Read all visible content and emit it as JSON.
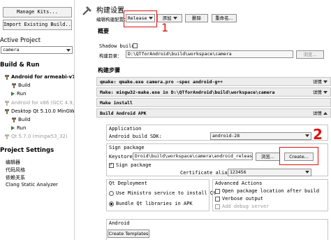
{
  "left": {
    "buttons": {
      "manage_kits": "Manage Kits...",
      "import_build": "Import Existing Build..."
    },
    "active_project_heading": "Active Project",
    "project_select_value": "camera",
    "build_run_heading": "Build & Run",
    "kits": [
      {
        "name": "Android for armeabi-v7a...",
        "build": "Build",
        "run": "Run",
        "active": true
      },
      {
        "name": "Android for x86 (GCC 4.9, ..."
      },
      {
        "name": "Desktop Qt 5.10.0 MinGW...",
        "build": "Build",
        "run": "Run"
      },
      {
        "name": "Qt 5.7.0 (mingw53_32)"
      }
    ],
    "project_settings_heading": "Project Settings",
    "settings_items": [
      "编辑器",
      "代码风格",
      "依赖关系",
      "Clang Static Analyzer"
    ]
  },
  "main": {
    "title": "构建设置",
    "edit_config_label": "编辑构建配置：",
    "config_value": "Release",
    "add_button": "添加",
    "delete_button": "删除",
    "rename_button": "重命名...",
    "general_heading": "概要",
    "shadow_build_label": "Shadow build:",
    "build_dir_label": "构建目录：",
    "build_dir_value": "D:\\QTforAndroid\\build\\workspace\\camera",
    "browse_label": "浏览...",
    "build_steps_heading": "构建步骤",
    "details_label": "详情",
    "steps": [
      "qmake: qmake.exe camera.pro -spec android-g++",
      "Make: mingw32-make.exe in D:\\QTforAndroid\\build\\workspace\\camera",
      "Make install",
      "Build Android APK"
    ],
    "apk": {
      "application_label": "Application",
      "sdk_label": "Android build SDK:",
      "sdk_value": "android-28",
      "sign_package_label": "Sign package",
      "keystore_label": "Keystore:",
      "keystore_value": "Droid\\build\\workspace\\camera\\android_release.keystore",
      "keystore_browse": "浏览...",
      "create_button": "Create...",
      "sign_checkbox_label": "Sign package",
      "cert_alias_label": "Certificate alias:",
      "cert_alias_value": "123456",
      "qt_deployment_label": "Qt Deployment",
      "ministro_label": "Use Ministro service to install Qt",
      "bundle_label": "Bundle Qt libraries in APK",
      "advanced_label": "Advanced Actions",
      "open_location_label": "Open package location after build",
      "verbose_label": "Verbose output",
      "debug_server_label": "Add debug server",
      "android_label": "Android",
      "create_templates": "Create Templates"
    },
    "annotations": {
      "mark1": "1",
      "mark2": "2"
    }
  },
  "colors": {
    "annotation_red": "#e01010",
    "run_green": "#3e7d3e",
    "disabled_gray": "#9a9a9a"
  }
}
